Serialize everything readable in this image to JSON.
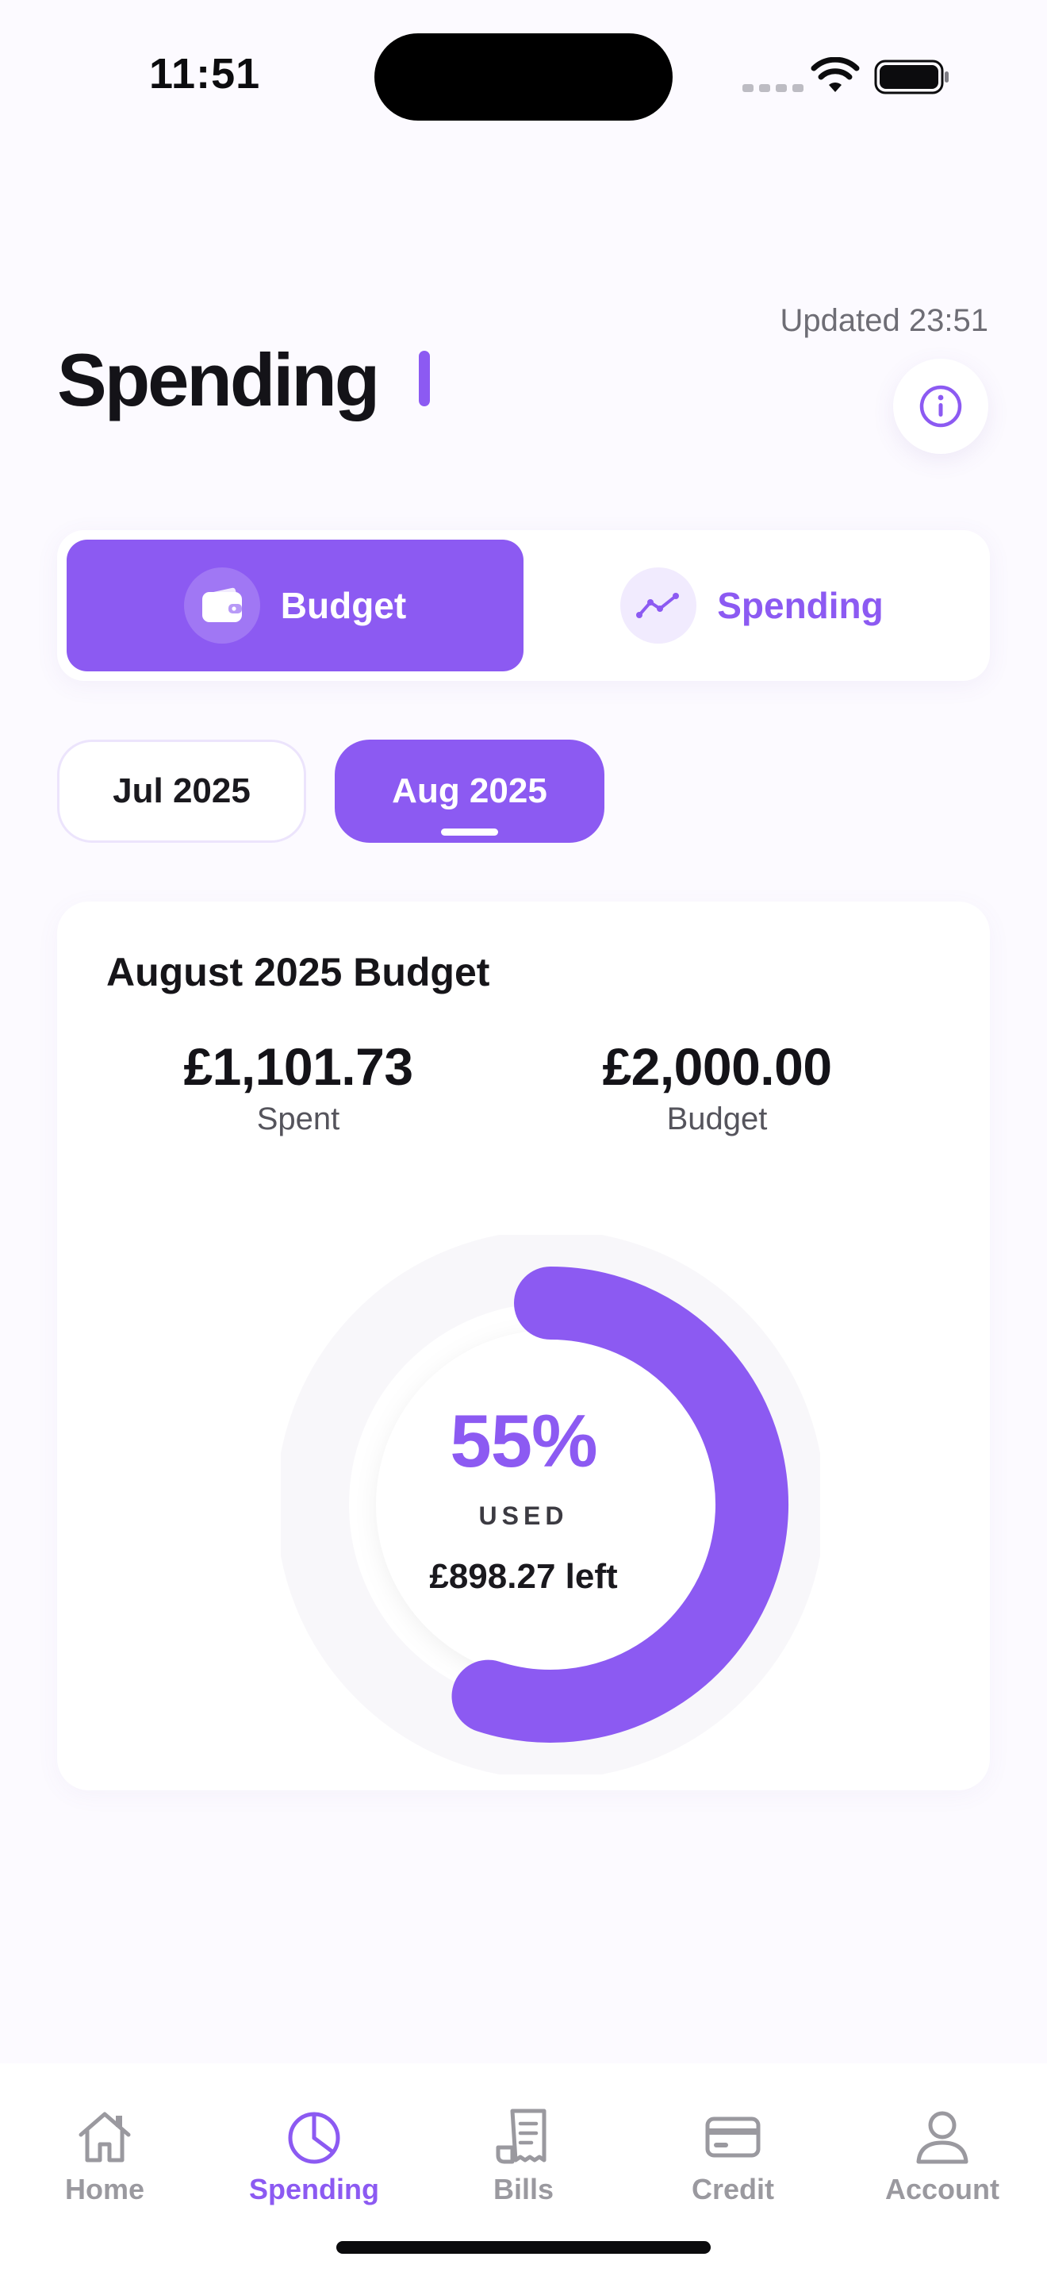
{
  "status_bar": {
    "time": "11:51"
  },
  "header": {
    "updated": "Updated 23:51",
    "title": "Spending"
  },
  "segmented": {
    "budget_label": "Budget",
    "spending_label": "Spending",
    "selected": "Budget"
  },
  "months": [
    {
      "label": "Jul 2025",
      "selected": false
    },
    {
      "label": "Aug 2025",
      "selected": true
    }
  ],
  "budget_card": {
    "title": "August 2025 Budget",
    "spent_value": "£1,101.73",
    "spent_label": "Spent",
    "budget_value": "£2,000.00",
    "budget_label": "Budget",
    "percent_used_text": "55%",
    "percent_used": 0.55,
    "used_caption": "USED",
    "left_text": "£898.27 left"
  },
  "tabbar": {
    "items": [
      {
        "label": "Home",
        "icon": "home-icon",
        "active": false
      },
      {
        "label": "Spending",
        "icon": "pie-chart-icon",
        "active": true
      },
      {
        "label": "Bills",
        "icon": "receipt-icon",
        "active": false
      },
      {
        "label": "Credit",
        "icon": "credit-card-icon",
        "active": false
      },
      {
        "label": "Account",
        "icon": "person-icon",
        "active": false
      }
    ]
  },
  "colors": {
    "accent": "#8c5af2",
    "background": "#fcfaff",
    "track": "#f8f7fa",
    "inactive_tab": "#9a999f"
  }
}
